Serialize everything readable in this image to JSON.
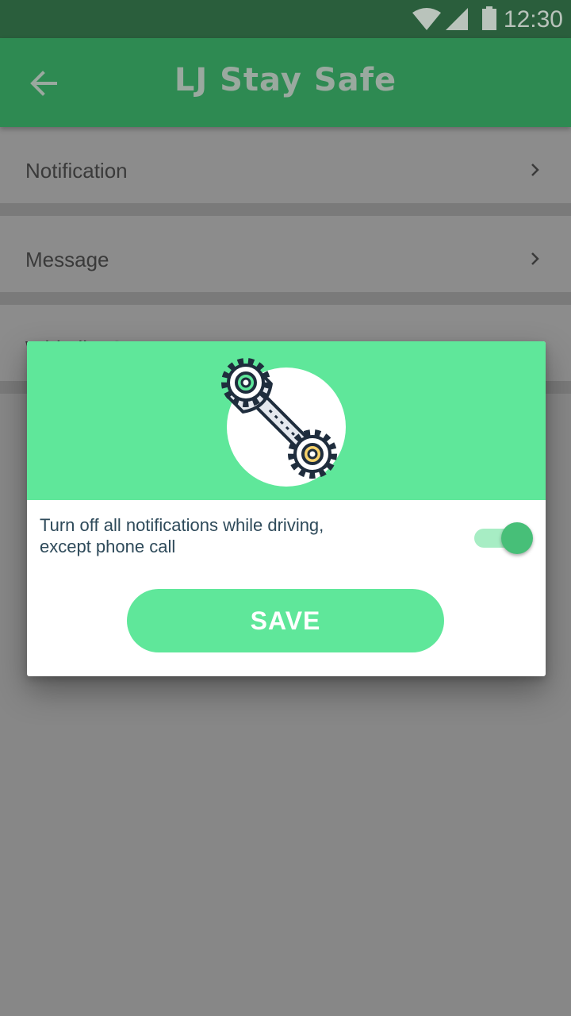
{
  "status_bar": {
    "time": "12:30",
    "icons": [
      "wifi-icon",
      "signal-icon",
      "battery-icon"
    ]
  },
  "app_bar": {
    "title": "LJ Stay Safe",
    "back_icon": "arrow-back-icon"
  },
  "settings": {
    "items": [
      {
        "label": "Notification",
        "icon": "chevron-right-icon"
      },
      {
        "label": "Message",
        "icon": "chevron-right-icon"
      },
      {
        "label": "Whitelist Contacts",
        "icon": "chevron-right-icon"
      }
    ]
  },
  "dialog": {
    "illustration": "wrench-gears-icon",
    "option_text_line1": "Turn off all notifications while driving,",
    "option_text_line2": "except phone call",
    "toggle_on": true,
    "save_label": "SAVE"
  },
  "colors": {
    "status_bar": "#2a5e3c",
    "app_bar": "#2e8a52",
    "accent": "#5fe79a",
    "toggle_thumb": "#47bf78",
    "scrim": "#878787"
  }
}
